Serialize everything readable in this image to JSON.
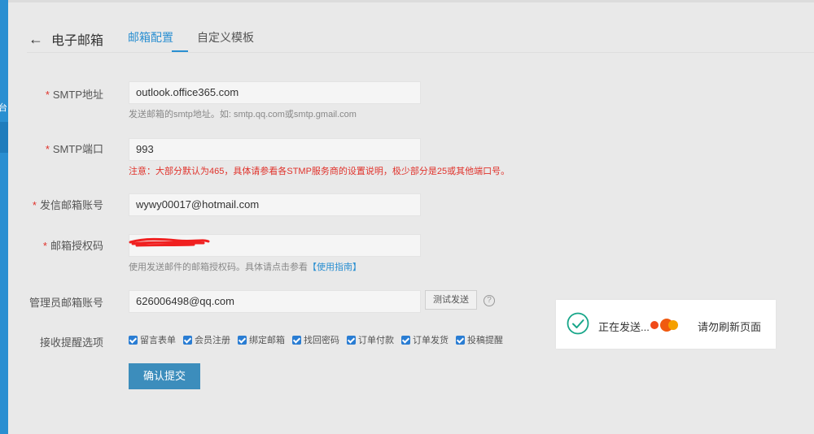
{
  "sidebar": {
    "fragment_text": "台"
  },
  "header": {
    "back_label": "电子邮箱",
    "tabs": [
      {
        "label": "邮箱配置",
        "active": true
      },
      {
        "label": "自定义模板",
        "active": false
      }
    ]
  },
  "form": {
    "required_mark": "*",
    "smtp_address": {
      "label": "SMTP地址",
      "value": "outlook.office365.com",
      "hint": "发送邮箱的smtp地址。如: smtp.qq.com或smtp.gmail.com"
    },
    "smtp_port": {
      "label": "SMTP端口",
      "value": "993",
      "hint": "注意：大部分默认为465，具体请参看各STMP服务商的设置说明，极少部分是25或其他端口号。"
    },
    "sender_account": {
      "label": "发信邮箱账号",
      "value": "wywy00017@hotmail.com"
    },
    "auth_code": {
      "label": "邮箱授权码",
      "hint_prefix": "使用发送邮件的邮箱授权码。具体请点击参看",
      "hint_link": "【使用指南】"
    },
    "admin_account": {
      "label": "管理员邮箱账号",
      "value": "626006498@qq.com",
      "test_button": "测试发送",
      "help_icon": "?"
    },
    "notify_options": {
      "label": "接收提醒选项",
      "items": [
        "留言表单",
        "会员注册",
        "绑定邮箱",
        "找回密码",
        "订单付款",
        "订单发货",
        "投稿提醒"
      ]
    },
    "submit_label": "确认提交"
  },
  "toast": {
    "sending_text": "正在发送...",
    "refresh_text": "请勿刷新页面"
  },
  "colors": {
    "accent": "#2a8fd1",
    "warning": "#e0322b",
    "success": "#17a689",
    "dot_red": "#f04a1a",
    "dot_orange": "#f5a000"
  }
}
